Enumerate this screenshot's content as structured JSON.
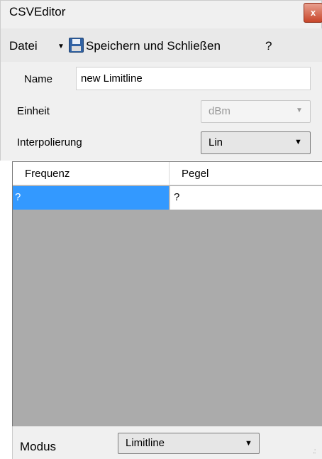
{
  "window": {
    "title": "CSVEditor",
    "close_glyph": "x"
  },
  "menu": {
    "file_label": "Datei",
    "file_arrow": "▼",
    "save_icon": "floppy-disk-icon",
    "save_label": "Speichern und Schließen",
    "help_label": "?"
  },
  "form": {
    "name_label": "Name",
    "name_value": "new Limitline",
    "unit_label": "Einheit",
    "unit_value": "dBm",
    "unit_enabled": false,
    "interp_label": "Interpolierung",
    "interp_value": "Lin"
  },
  "grid": {
    "columns": [
      "Frequenz",
      "Pegel"
    ],
    "rows": [
      [
        "?",
        "?"
      ]
    ],
    "selected_color": "#3399ff",
    "empty_color": "#ababab"
  },
  "mode": {
    "label": "Modus",
    "value": "Limitline"
  },
  "dropdown_arrow": "▼"
}
